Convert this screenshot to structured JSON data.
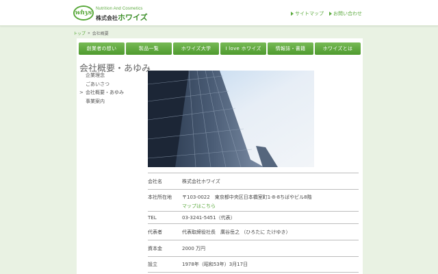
{
  "header": {
    "logo_mark": "whys",
    "logo_tagline": "Nutrition And Cosmetics",
    "logo_name_prefix": "株式会社",
    "logo_name": "ホワイズ",
    "links": [
      "サイトマップ",
      "お問い合わせ"
    ]
  },
  "breadcrumb": {
    "home": "トップ",
    "sep": "»",
    "current": "会社概要"
  },
  "nav": {
    "items": [
      "創業者の想い",
      "製品一覧",
      "ホワイズ大学",
      "I love ホワイズ",
      "情報誌・書籍",
      "ホワイズとは"
    ]
  },
  "page": {
    "title": "会社概要・あゆみ"
  },
  "subnav": {
    "items": [
      "企業理念",
      "ごあいさつ",
      "会社概要・あゆみ",
      "事業案内"
    ]
  },
  "table": {
    "rows": [
      {
        "label": "会社名",
        "value": "株式会社ホワイズ"
      },
      {
        "label": "本社所在地",
        "value": "〒103-0022　東京都中央区日本橋室町1-8-8ちばやビル8階",
        "link": "マップはこちら"
      },
      {
        "label": "TEL",
        "value": "03-3241-5451（代表）"
      },
      {
        "label": "代表者",
        "value": "代表取締役社長　廣谷岳之 （ひろたに たけゆき）"
      },
      {
        "label": "資本金",
        "value": "2000 万円"
      },
      {
        "label": "設立",
        "value": "1978年（昭和53年）3月17日"
      }
    ]
  },
  "colors": {
    "accent": "#5aa93c",
    "nav_top": "#77ba55",
    "nav_bottom": "#4e9a2e",
    "background": "#e9f2e3"
  },
  "icons": {
    "header_link_marker": "triangle-right-icon",
    "breadcrumb_separator": "double-chevron-icon"
  }
}
